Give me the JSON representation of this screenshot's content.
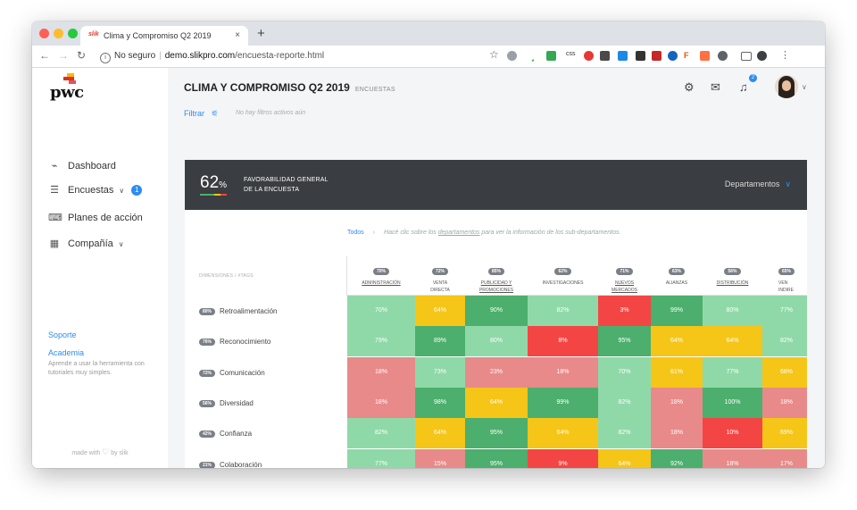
{
  "browser": {
    "tab_title": "Clima y Compromiso Q2 2019",
    "tab_favicon": "slik",
    "tab_close": "×",
    "new_tab": "+",
    "security": "No seguro",
    "url_host": "demo.slikpro.com",
    "url_path": "/encuesta-reporte.html",
    "ext_text": "css"
  },
  "sidebar": {
    "logo": "pwc",
    "items": [
      {
        "label": "Dashboard",
        "icon": "chart-icon"
      },
      {
        "label": "Encuestas",
        "icon": "document-icon",
        "badge": "1"
      },
      {
        "label": "Planes de acción",
        "icon": "presentation-icon"
      },
      {
        "label": "Compañía",
        "icon": "building-icon"
      }
    ],
    "support": "Soporte",
    "academy": "Academia",
    "academy_desc": "Aprende a usar la herramienta con tutoriales muy simples.",
    "made_with": "made with",
    "made_by": "by slik"
  },
  "header": {
    "title": "CLIMA Y COMPROMISO Q2 2019",
    "subtitle": "ENCUESTAS",
    "filter": "Filtrar",
    "no_filters": "No hay filtros activos aún",
    "notif_count": "2"
  },
  "summary": {
    "pct_value": "62",
    "pct_sign": "%",
    "label_line1": "FAVORABILIDAD GENERAL",
    "label_line2": "DE LA ENCUESTA",
    "dropdown": "Departamentos"
  },
  "breadcrumb": {
    "root": "Todos",
    "sep": "›",
    "hint_pre": "Hacé clic sobre los",
    "hint_link": "departamentos",
    "hint_post": "para ver la información de los sub-departamentos."
  },
  "table": {
    "dim_header": "DIMENSIONES / #TAGS",
    "columns": [
      {
        "pct": "70%",
        "line1": "ADMINISTRACIÓN",
        "line2": "",
        "link": true
      },
      {
        "pct": "72%",
        "line1": "VENTA",
        "line2": "DIRECTA",
        "link": false
      },
      {
        "pct": "85%",
        "line1": "PUBLICIDAD Y",
        "line2": "PROMOCIONES",
        "link": true
      },
      {
        "pct": "62%",
        "line1": "INVESTIGACIONES",
        "line2": "",
        "link": false
      },
      {
        "pct": "71%",
        "line1": "NUEVOS",
        "line2": "MERCADOS",
        "link": true
      },
      {
        "pct": "63%",
        "line1": "ALIANZAS",
        "line2": "",
        "link": false
      },
      {
        "pct": "56%",
        "line1": "DISTRIBUCIÓN",
        "line2": "",
        "link": true
      },
      {
        "pct": "65%",
        "line1": "VEN",
        "line2": "INDIRE",
        "link": false
      }
    ],
    "rows": [
      {
        "pct": "80%",
        "label": "Retroalimentación",
        "cells": [
          "70%",
          "64%",
          "90%",
          "82%",
          "3%",
          "99%",
          "80%",
          "77%"
        ]
      },
      {
        "pct": "76%",
        "label": "Reconocimiento",
        "cells": [
          "79%",
          "89%",
          "80%",
          "8%",
          "95%",
          "64%",
          "64%",
          "82%"
        ]
      },
      {
        "pct": "72%",
        "label": "Comunicación",
        "cells": [
          "18%",
          "73%",
          "23%",
          "18%",
          "70%",
          "61%",
          "77%",
          "68%"
        ]
      },
      {
        "pct": "56%",
        "label": "Diversidad",
        "cells": [
          "18%",
          "98%",
          "64%",
          "99%",
          "82%",
          "18%",
          "100%",
          "18%"
        ]
      },
      {
        "pct": "42%",
        "label": "Confianza",
        "cells": [
          "82%",
          "64%",
          "95%",
          "64%",
          "82%",
          "18%",
          "10%",
          "69%"
        ]
      },
      {
        "pct": "21%",
        "label": "Colaboración",
        "cells": [
          "77%",
          "15%",
          "95%",
          "9%",
          "64%",
          "92%",
          "18%",
          "17%"
        ]
      }
    ],
    "cell_colors": [
      [
        "#8fd9a8",
        "#f5c518",
        "#4caf6d",
        "#8fd9a8",
        "#f44545",
        "#4caf6d",
        "#8fd9a8",
        "#8fd9a8"
      ],
      [
        "#8fd9a8",
        "#4caf6d",
        "#8fd9a8",
        "#f44545",
        "#4caf6d",
        "#f5c518",
        "#f5c518",
        "#8fd9a8"
      ],
      [
        "#e88a8a",
        "#8fd9a8",
        "#e88a8a",
        "#e88a8a",
        "#8fd9a8",
        "#f5c518",
        "#8fd9a8",
        "#f5c518"
      ],
      [
        "#e88a8a",
        "#4caf6d",
        "#f5c518",
        "#4caf6d",
        "#8fd9a8",
        "#e88a8a",
        "#4caf6d",
        "#e88a8a"
      ],
      [
        "#8fd9a8",
        "#f5c518",
        "#4caf6d",
        "#f5c518",
        "#8fd9a8",
        "#e88a8a",
        "#f44545",
        "#f5c518"
      ],
      [
        "#8fd9a8",
        "#e88a8a",
        "#4caf6d",
        "#f44545",
        "#f5c518",
        "#4caf6d",
        "#e88a8a",
        "#e88a8a"
      ]
    ],
    "partial_row_colors": [
      "#e88a8a",
      "#8fd9a8",
      "#e88a8a",
      "#e88a8a",
      "#8fd9a8",
      "#f5c518",
      "#8fd9a8",
      "#f5c518"
    ]
  },
  "colors": {
    "accent": "#2d8cf0",
    "summary_bg": "#3a3d41",
    "pill": "#7b7f86"
  }
}
